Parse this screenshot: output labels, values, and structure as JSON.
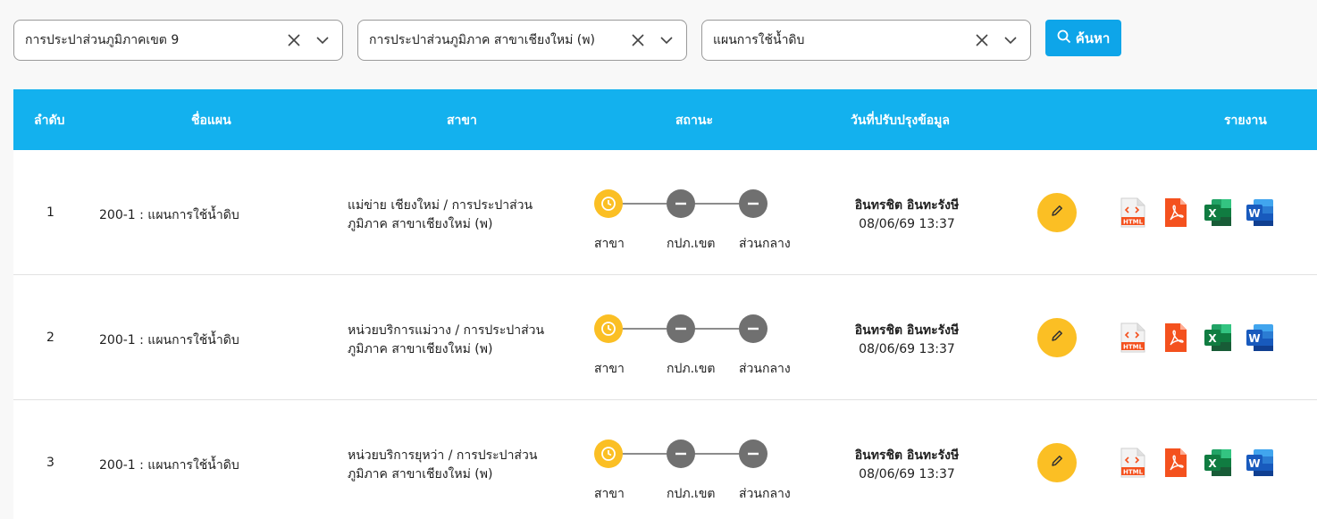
{
  "filters": {
    "region": "การประปาส่วนภูมิภาคเขต 9",
    "branch": "การประปาส่วนภูมิภาค สาขาเชียงใหม่ (พ)",
    "plan": "แผนการใช้น้ำดิบ",
    "search_label": "ค้นหา"
  },
  "table": {
    "headers": {
      "no": "ลำดับ",
      "name": "ชื่อแผน",
      "branch": "สาขา",
      "status": "สถานะ",
      "updated": "วันที่ปรับปรุงข้อมูล",
      "report": "รายงาน"
    },
    "rows": [
      {
        "no": "1",
        "plan": "200-1 : แผนการใช้น้ำดิบ",
        "branch": "แม่ข่าย เชียงใหม่ / การประปาส่วนภูมิภาค สาขาเชียงใหม่ (พ)",
        "steps": [
          "สาขา",
          "กปภ.เขต",
          "ส่วนกลาง"
        ],
        "updated_by": "อินทรชิต อินทะรังษี",
        "updated_at": "08/06/69 13:37"
      },
      {
        "no": "2",
        "plan": "200-1 : แผนการใช้น้ำดิบ",
        "branch": "หน่วยบริการแม่วาง / การประปาส่วนภูมิภาค สาขาเชียงใหม่ (พ)",
        "steps": [
          "สาขา",
          "กปภ.เขต",
          "ส่วนกลาง"
        ],
        "updated_by": "อินทรชิต อินทะรังษี",
        "updated_at": "08/06/69 13:37"
      },
      {
        "no": "3",
        "plan": "200-1 : แผนการใช้น้ำดิบ",
        "branch": "หน่วยบริการยุหว่า / การประปาส่วนภูมิภาค สาขาเชียงใหม่ (พ)",
        "steps": [
          "สาขา",
          "กปภ.เขต",
          "ส่วนกลาง"
        ],
        "updated_by": "อินทรชิต อินทะรังษี",
        "updated_at": "08/06/69 13:37"
      }
    ]
  },
  "report_icons": {
    "html": "HTML",
    "excel": "X",
    "word": "W"
  },
  "colors": {
    "header": "#13b1ee",
    "search_button": "#0ea5e9",
    "step_active": "#fbbf24",
    "step_inactive": "#707070",
    "edit_button": "#fbbf24",
    "pdf": "#f4511e",
    "excel": "#1f7a44",
    "word": "#2b579a"
  },
  "icons": {
    "clear": "close-icon",
    "dropdown": "chevron-down-icon",
    "search": "search-icon",
    "step_active": "clock-icon",
    "step_pending": "minus-icon",
    "edit": "pencil-icon"
  }
}
